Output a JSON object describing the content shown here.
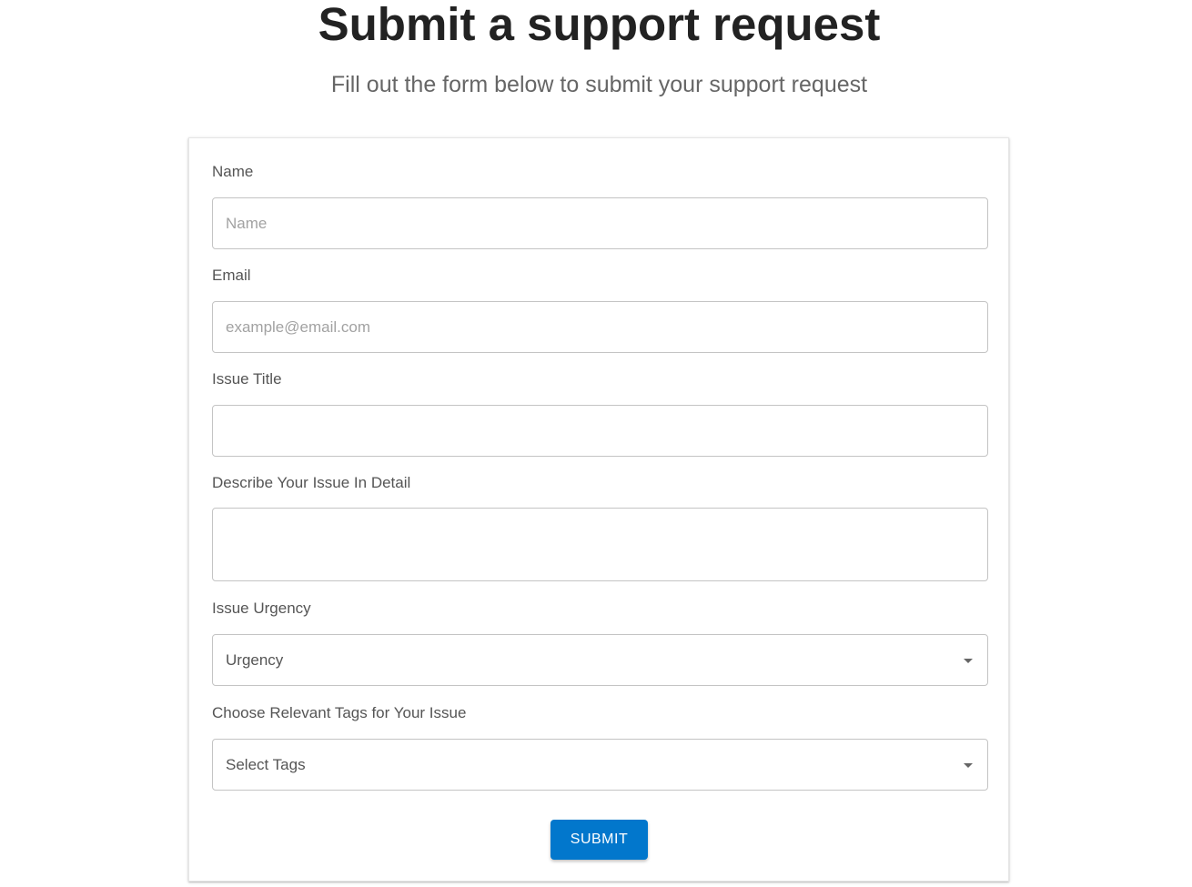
{
  "header": {
    "title": "Submit a support request",
    "subtitle": "Fill out the form below to submit your support request"
  },
  "form": {
    "name": {
      "label": "Name",
      "placeholder": "Name",
      "value": ""
    },
    "email": {
      "label": "Email",
      "placeholder": "example@email.com",
      "value": ""
    },
    "issue_title": {
      "label": "Issue Title",
      "value": ""
    },
    "description": {
      "label": "Describe Your Issue In Detail",
      "value": ""
    },
    "urgency": {
      "label": "Issue Urgency",
      "selected": "Urgency",
      "icon": "chevron-down-icon"
    },
    "tags": {
      "label": "Choose Relevant Tags for Your Issue",
      "selected": "Select Tags",
      "icon": "chevron-down-icon"
    },
    "submit_label": "SUBMIT"
  },
  "colors": {
    "accent": "#0277cc",
    "title": "#222222",
    "label": "#555555",
    "border": "#c4c4c4"
  }
}
